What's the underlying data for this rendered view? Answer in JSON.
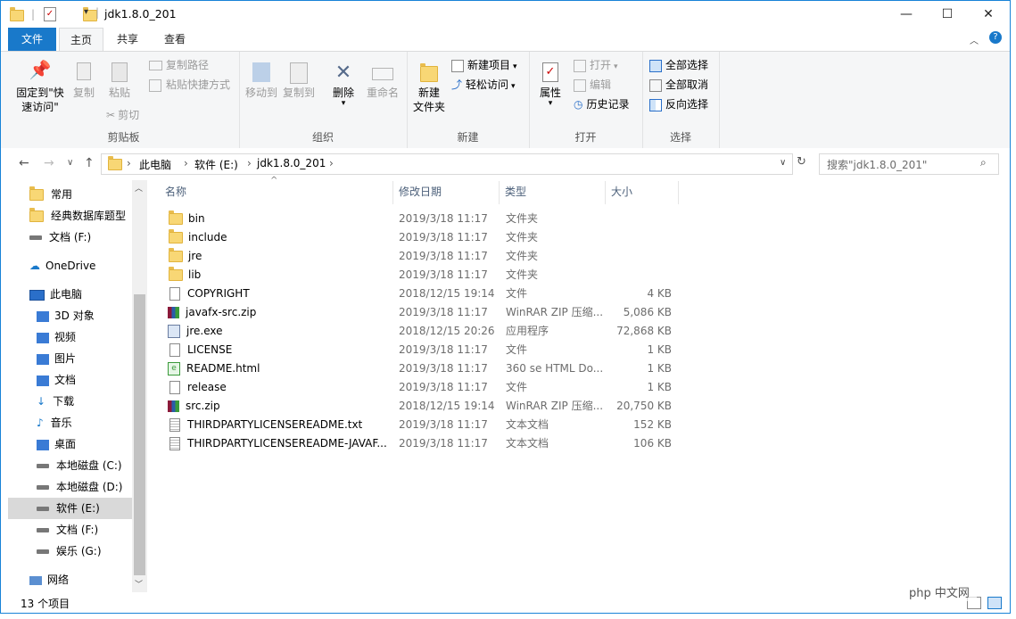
{
  "window": {
    "title": "jdk1.8.0_201"
  },
  "tabs": [
    {
      "label": "文件"
    },
    {
      "label": "主页"
    },
    {
      "label": "共享"
    },
    {
      "label": "查看"
    }
  ],
  "ribbon": {
    "clipboard": {
      "label": "剪贴板",
      "pin": "固定到\"快\n速访问\"",
      "pin_line1": "固定到\"快",
      "pin_line2": "速访问\"",
      "copy": "复制",
      "paste": "粘贴",
      "copy_path": "复制路径",
      "paste_shortcut": "粘贴快捷方式",
      "cut": "剪切"
    },
    "organize": {
      "label": "组织",
      "move_to": "移动到",
      "copy_to": "复制到",
      "delete": "删除",
      "rename": "重命名"
    },
    "new": {
      "label": "新建",
      "new_folder_line1": "新建",
      "new_folder_line2": "文件夹",
      "new_item": "新建项目",
      "easy_access": "轻松访问"
    },
    "open": {
      "label": "打开",
      "properties": "属性",
      "open": "打开",
      "edit": "编辑",
      "history": "历史记录"
    },
    "select": {
      "label": "选择",
      "select_all": "全部选择",
      "select_none": "全部取消",
      "invert": "反向选择"
    }
  },
  "address": {
    "crumbs": [
      "此电脑",
      "软件 (E:)",
      "jdk1.8.0_201"
    ],
    "search_placeholder": "搜索\"jdk1.8.0_201\""
  },
  "nav": [
    {
      "label": "常用",
      "icon": "folder-icon"
    },
    {
      "label": "经典数据库题型",
      "icon": "folder-icon"
    },
    {
      "label": "文档 (F:)",
      "icon": "drive-icon"
    },
    {
      "label": "OneDrive",
      "icon": "cloud-icon"
    },
    {
      "label": "此电脑",
      "icon": "computer-icon"
    },
    {
      "label": "3D 对象",
      "icon": "cube-icon"
    },
    {
      "label": "视频",
      "icon": "video-icon"
    },
    {
      "label": "图片",
      "icon": "picture-icon"
    },
    {
      "label": "文档",
      "icon": "document-icon"
    },
    {
      "label": "下载",
      "icon": "download-icon"
    },
    {
      "label": "音乐",
      "icon": "music-icon"
    },
    {
      "label": "桌面",
      "icon": "desktop-icon"
    },
    {
      "label": "本地磁盘 (C:)",
      "icon": "drive-icon"
    },
    {
      "label": "本地磁盘 (D:)",
      "icon": "drive-icon"
    },
    {
      "label": "软件 (E:)",
      "icon": "drive-icon"
    },
    {
      "label": "文档 (F:)",
      "icon": "drive-icon"
    },
    {
      "label": "娱乐 (G:)",
      "icon": "drive-icon"
    },
    {
      "label": "网络",
      "icon": "network-icon"
    }
  ],
  "columns": {
    "name": "名称",
    "date": "修改日期",
    "type": "类型",
    "size": "大小"
  },
  "files": [
    {
      "name": "bin",
      "date": "2019/3/18 11:17",
      "type": "文件夹",
      "size": "",
      "icon": "folder"
    },
    {
      "name": "include",
      "date": "2019/3/18 11:17",
      "type": "文件夹",
      "size": "",
      "icon": "folder"
    },
    {
      "name": "jre",
      "date": "2019/3/18 11:17",
      "type": "文件夹",
      "size": "",
      "icon": "folder"
    },
    {
      "name": "lib",
      "date": "2019/3/18 11:17",
      "type": "文件夹",
      "size": "",
      "icon": "folder"
    },
    {
      "name": "COPYRIGHT",
      "date": "2018/12/15 19:14",
      "type": "文件",
      "size": "4 KB",
      "icon": "file"
    },
    {
      "name": "javafx-src.zip",
      "date": "2019/3/18 11:17",
      "type": "WinRAR ZIP 压缩...",
      "size": "5,086 KB",
      "icon": "zip"
    },
    {
      "name": "jre.exe",
      "date": "2018/12/15 20:26",
      "type": "应用程序",
      "size": "72,868 KB",
      "icon": "exe"
    },
    {
      "name": "LICENSE",
      "date": "2019/3/18 11:17",
      "type": "文件",
      "size": "1 KB",
      "icon": "file"
    },
    {
      "name": "README.html",
      "date": "2019/3/18 11:17",
      "type": "360 se HTML Do...",
      "size": "1 KB",
      "icon": "html"
    },
    {
      "name": "release",
      "date": "2019/3/18 11:17",
      "type": "文件",
      "size": "1 KB",
      "icon": "file"
    },
    {
      "name": "src.zip",
      "date": "2018/12/15 19:14",
      "type": "WinRAR ZIP 压缩...",
      "size": "20,750 KB",
      "icon": "zip"
    },
    {
      "name": "THIRDPARTYLICENSEREADME.txt",
      "date": "2019/3/18 11:17",
      "type": "文本文档",
      "size": "152 KB",
      "icon": "txt"
    },
    {
      "name": "THIRDPARTYLICENSEREADME-JAVAF...",
      "date": "2019/3/18 11:17",
      "type": "文本文档",
      "size": "106 KB",
      "icon": "txt"
    }
  ],
  "status": {
    "count": "13 个项目"
  },
  "watermark": "php 中文网"
}
